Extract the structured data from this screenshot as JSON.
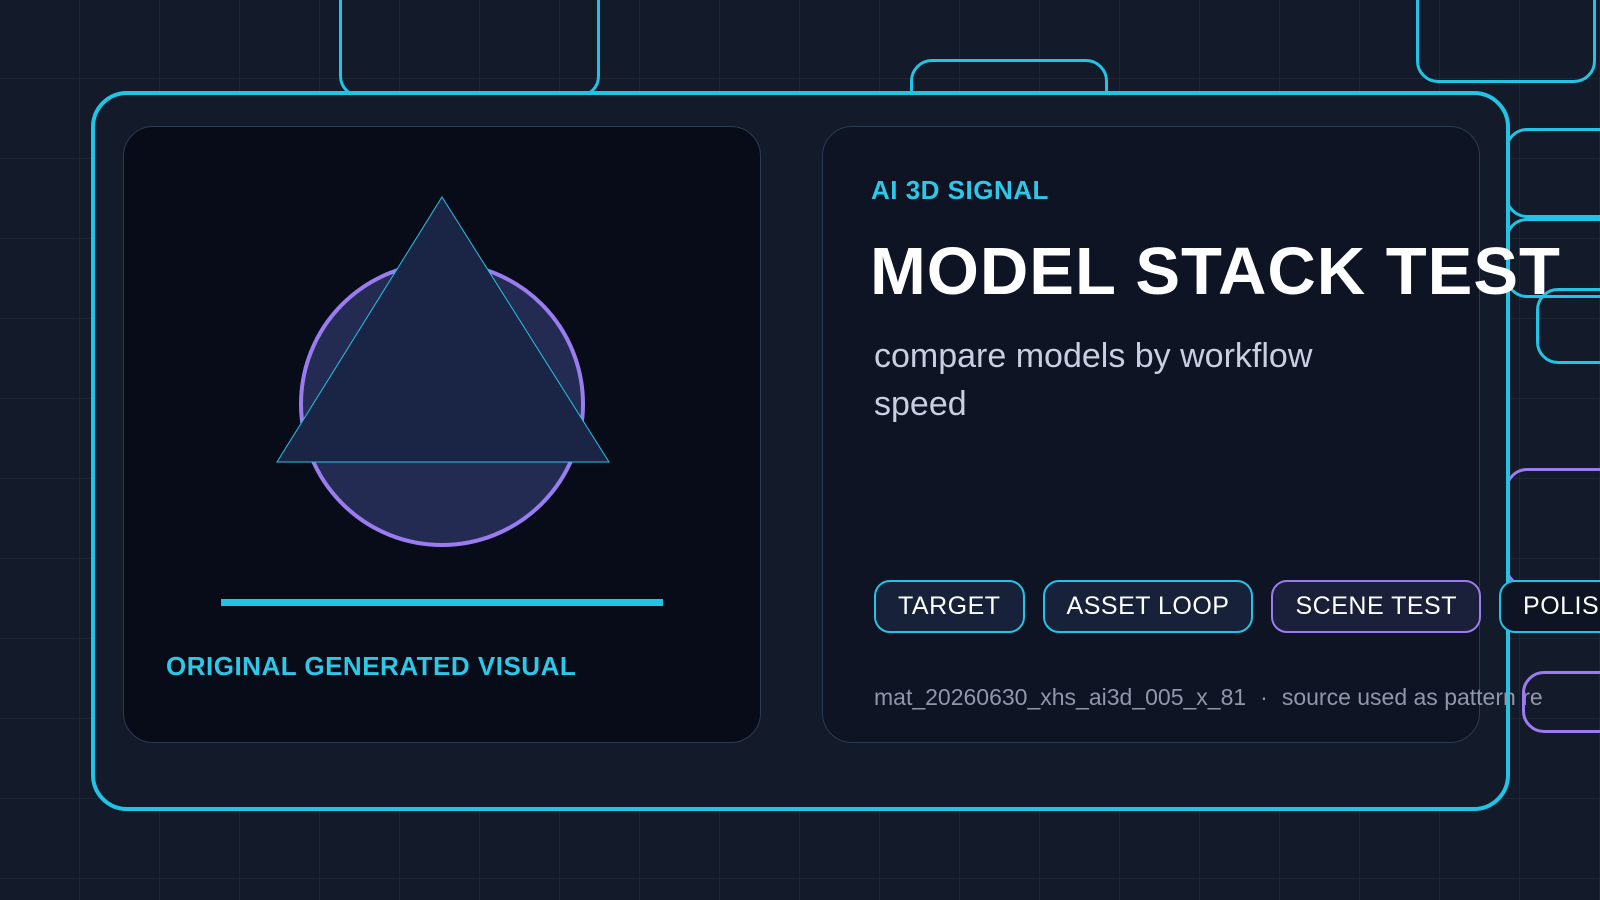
{
  "visual": {
    "caption": "ORIGINAL GENERATED VISUAL",
    "progress": 1.0
  },
  "info": {
    "eyebrow": "AI 3D SIGNAL",
    "title": "MODEL STACK TEST",
    "subtitle": "compare models by workflow speed",
    "tags": [
      "TARGET",
      "ASSET LOOP",
      "SCENE TEST",
      "POLISH"
    ],
    "footer_id": "mat_20260630_xhs_ai3d_005_x_81",
    "footer_separator": "·",
    "footer_note": "source used as pattern re"
  },
  "colors": {
    "accent_cyan": "#22c4e6",
    "accent_purple": "#9b7cf0",
    "background": "#131a29",
    "panel_dark": "#080c18"
  }
}
